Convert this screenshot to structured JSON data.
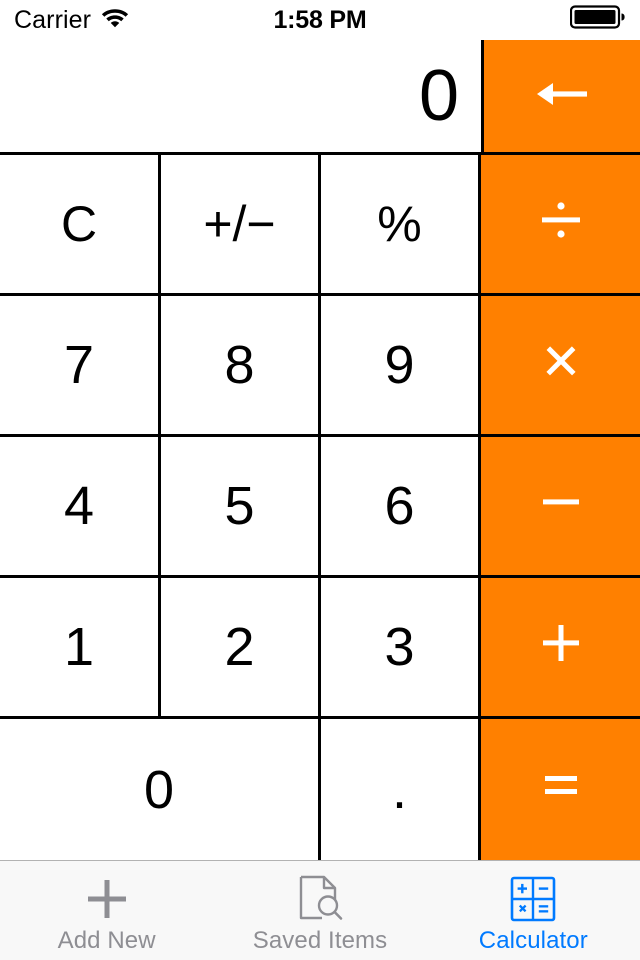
{
  "status_bar": {
    "carrier": "Carrier",
    "wifi_icon": "wifi-icon",
    "time": "1:58 PM",
    "battery_icon": "battery-full-icon"
  },
  "display": {
    "value": "0",
    "backspace_icon": "backspace-arrow-icon",
    "backspace_label": "←"
  },
  "colors": {
    "operator_orange": "#FF8000",
    "key_text": "#000000",
    "operator_text": "#FFFFFF",
    "tab_active": "#007AFF",
    "tab_inactive": "#8E8E93",
    "tab_bar_bg": "#F8F8F8",
    "grid_line": "#000000"
  },
  "keypad": {
    "rows": [
      [
        {
          "label": "C",
          "name": "key-clear",
          "type": "func"
        },
        {
          "label": "+/−",
          "name": "key-sign",
          "type": "func"
        },
        {
          "label": "%",
          "name": "key-percent",
          "type": "func"
        },
        {
          "label": "÷",
          "name": "key-divide",
          "type": "op"
        }
      ],
      [
        {
          "label": "7",
          "name": "key-7",
          "type": "num"
        },
        {
          "label": "8",
          "name": "key-8",
          "type": "num"
        },
        {
          "label": "9",
          "name": "key-9",
          "type": "num"
        },
        {
          "label": "×",
          "name": "key-multiply",
          "type": "op"
        }
      ],
      [
        {
          "label": "4",
          "name": "key-4",
          "type": "num"
        },
        {
          "label": "5",
          "name": "key-5",
          "type": "num"
        },
        {
          "label": "6",
          "name": "key-6",
          "type": "num"
        },
        {
          "label": "−",
          "name": "key-subtract",
          "type": "op"
        }
      ],
      [
        {
          "label": "1",
          "name": "key-1",
          "type": "num"
        },
        {
          "label": "2",
          "name": "key-2",
          "type": "num"
        },
        {
          "label": "3",
          "name": "key-3",
          "type": "num"
        },
        {
          "label": "+",
          "name": "key-add",
          "type": "op"
        }
      ],
      [
        {
          "label": "0",
          "name": "key-0",
          "type": "num",
          "span": 2
        },
        {
          "label": ".",
          "name": "key-decimal",
          "type": "dot"
        },
        {
          "label": "=",
          "name": "key-equals",
          "type": "op"
        }
      ]
    ]
  },
  "tab_bar": {
    "items": [
      {
        "label": "Add New",
        "name": "tab-add-new",
        "icon": "plus-icon",
        "active": false
      },
      {
        "label": "Saved Items",
        "name": "tab-saved-items",
        "icon": "document-search-icon",
        "active": false
      },
      {
        "label": "Calculator",
        "name": "tab-calculator",
        "icon": "calculator-grid-icon",
        "active": true
      }
    ]
  }
}
